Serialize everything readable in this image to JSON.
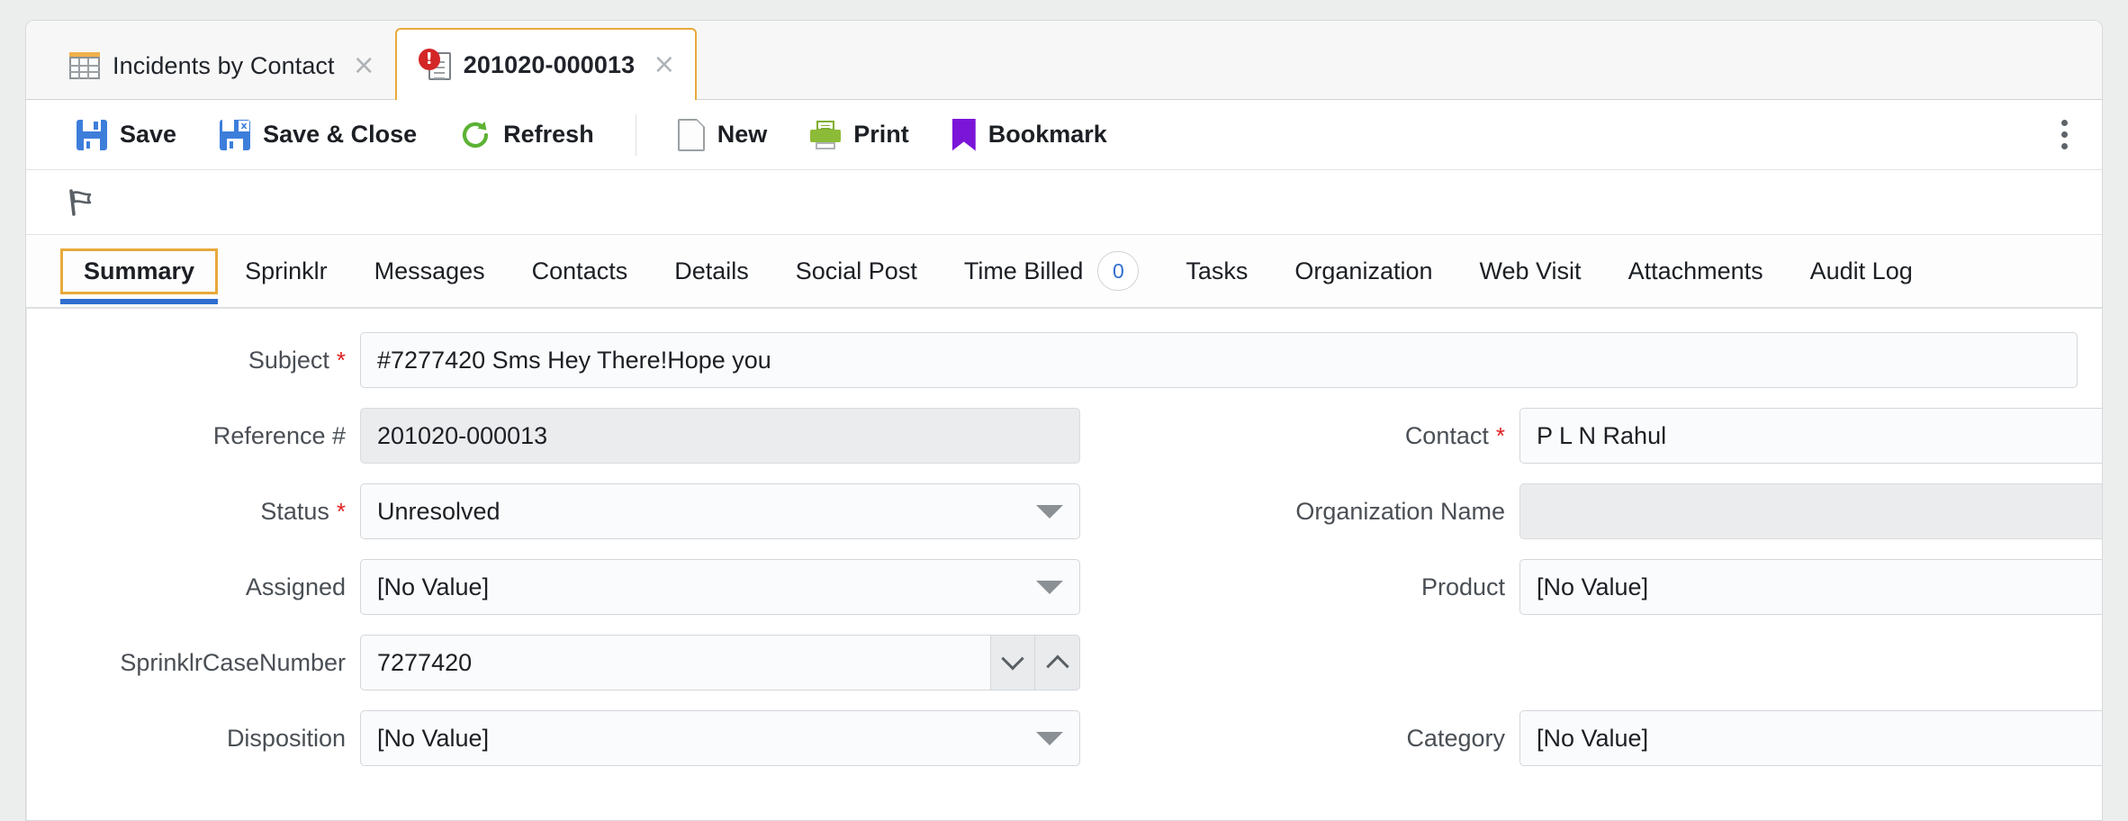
{
  "window": {
    "doc_tabs": [
      {
        "label": "Incidents by Contact",
        "icon": "grid-icon",
        "active": false,
        "close": "×"
      },
      {
        "label": "201020-000013",
        "icon": "document-alert-icon",
        "active": true,
        "close": "×"
      }
    ]
  },
  "toolbar": {
    "save_label": "Save",
    "save_close_label": "Save & Close",
    "refresh_label": "Refresh",
    "new_label": "New",
    "print_label": "Print",
    "bookmark_label": "Bookmark",
    "overflow_icon": "kebab-menu-icon"
  },
  "flagbar": {
    "flag_icon": "flag-icon"
  },
  "nav": {
    "tabs": [
      {
        "label": "Summary",
        "active": true,
        "badge": null
      },
      {
        "label": "Sprinklr",
        "active": false,
        "badge": null
      },
      {
        "label": "Messages",
        "active": false,
        "badge": null
      },
      {
        "label": "Contacts",
        "active": false,
        "badge": null
      },
      {
        "label": "Details",
        "active": false,
        "badge": null
      },
      {
        "label": "Social Post",
        "active": false,
        "badge": null
      },
      {
        "label": "Time Billed",
        "active": false,
        "badge": "0"
      },
      {
        "label": "Tasks",
        "active": false,
        "badge": null
      },
      {
        "label": "Organization",
        "active": false,
        "badge": null
      },
      {
        "label": "Web Visit",
        "active": false,
        "badge": null
      },
      {
        "label": "Attachments",
        "active": false,
        "badge": null
      },
      {
        "label": "Audit Log",
        "active": false,
        "badge": null
      }
    ]
  },
  "form": {
    "subject": {
      "label": "Subject",
      "value": "#7277420 Sms Hey There!Hope you"
    },
    "reference": {
      "label": "Reference #",
      "value": "201020-000013"
    },
    "contact": {
      "label": "Contact",
      "value": "P L N Rahul"
    },
    "status": {
      "label": "Status",
      "value": "Unresolved"
    },
    "org_name": {
      "label": "Organization Name",
      "value": ""
    },
    "assigned": {
      "label": "Assigned",
      "value": "[No Value]"
    },
    "product": {
      "label": "Product",
      "value": "[No Value]"
    },
    "case_number": {
      "label": "SprinklrCaseNumber",
      "value": "7277420"
    },
    "disposition": {
      "label": "Disposition",
      "value": "[No Value]"
    },
    "category": {
      "label": "Category",
      "value": "[No Value]"
    },
    "required_marker": "*"
  },
  "colors": {
    "focus_ring": "#e8a93c",
    "active_underline": "#2f6fd0",
    "required": "#e01f1f",
    "save_icon": "#3d7edb",
    "refresh_icon": "#5cb235",
    "print_icon": "#8cbb38",
    "bookmark_icon": "#7b16d8",
    "alert_badge": "#d32626"
  }
}
